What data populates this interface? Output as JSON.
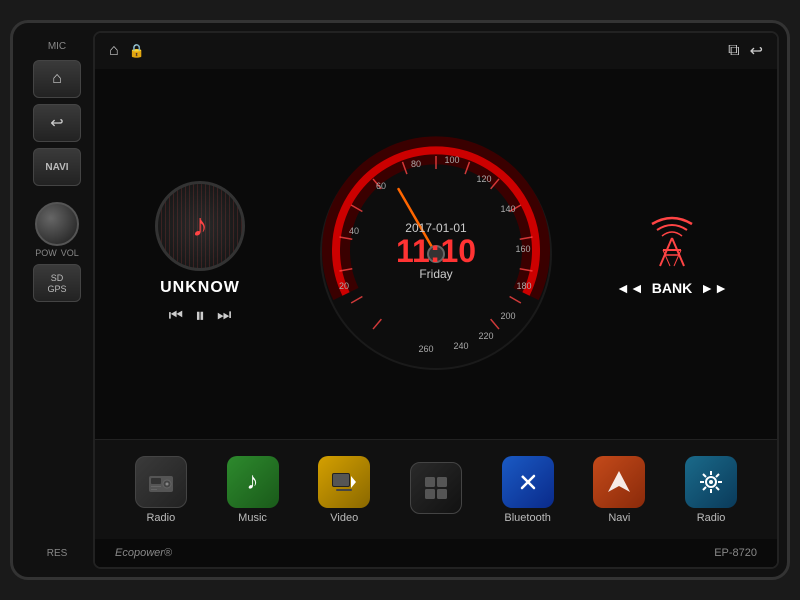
{
  "device": {
    "brand": "Ecopower",
    "brand_symbol": "®",
    "model": "EP-8720"
  },
  "topbar": {
    "home_icon": "⌂",
    "lock_icon": "🔒",
    "window_icon": "⧉",
    "back_icon": "↩"
  },
  "left_panel": {
    "mic_label": "MIC",
    "home_btn": "⌂",
    "back_btn": "↩",
    "navi_label": "NAVI",
    "pow_label": "POW",
    "vol_label": "VOL",
    "sd_label": "SD",
    "gps_label": "GPS",
    "res_label": "RES"
  },
  "music": {
    "title": "UNKNOW",
    "prev_icon": "⏮",
    "play_icon": "⏸",
    "next_icon": "⏭"
  },
  "clock": {
    "date": "2017-01-01",
    "time": "11:10",
    "day": "Friday"
  },
  "radio": {
    "station": "BANK",
    "prev_icon": "◄◄",
    "next_icon": "►►"
  },
  "apps": [
    {
      "id": "radio",
      "label": "Radio",
      "icon": "📻",
      "color_class": "app-radio-icon"
    },
    {
      "id": "music",
      "label": "Music",
      "icon": "🎵",
      "color_class": "app-music-icon"
    },
    {
      "id": "video",
      "label": "Video",
      "icon": "📹",
      "color_class": "app-video-icon"
    },
    {
      "id": "apps",
      "label": "",
      "icon": "⊞",
      "color_class": "app-apps-icon"
    },
    {
      "id": "bluetooth",
      "label": "Bluetooth",
      "icon": "🔷",
      "color_class": "app-bt-icon"
    },
    {
      "id": "navi",
      "label": "Navi",
      "icon": "🧭",
      "color_class": "app-navi-icon"
    },
    {
      "id": "settings",
      "label": "Radio",
      "icon": "⚙",
      "color_class": "app-settings-icon"
    }
  ]
}
